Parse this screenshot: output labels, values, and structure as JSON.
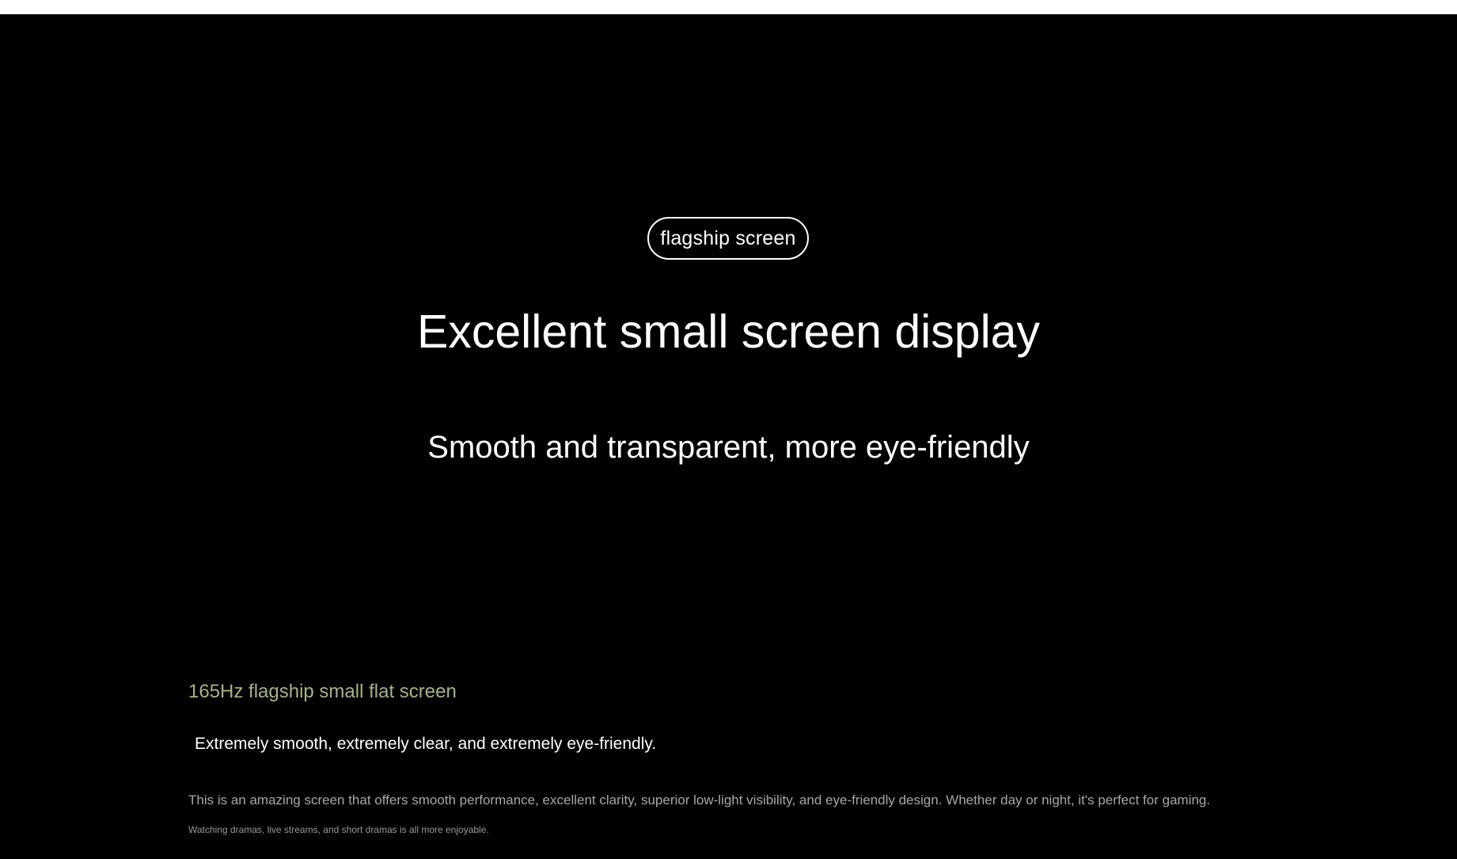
{
  "hero": {
    "badge": "flagship screen",
    "headline": "Excellent small screen display",
    "subheadline": "Smooth and transparent, more eye-friendly"
  },
  "feature": {
    "title": "165Hz flagship small flat screen",
    "tagline": "Extremely smooth, extremely clear, and extremely eye-friendly.",
    "description": "This is an amazing screen that offers smooth performance, excellent clarity, superior low-light visibility, and eye-friendly design. Whether day or night, it's perfect for gaming.",
    "note": "Watching dramas, live streams, and short dramas is all more enjoyable."
  },
  "colors": {
    "background": "#000000",
    "accent": "#a6b389",
    "text": "#ffffff",
    "muted": "#a7a7a7"
  }
}
